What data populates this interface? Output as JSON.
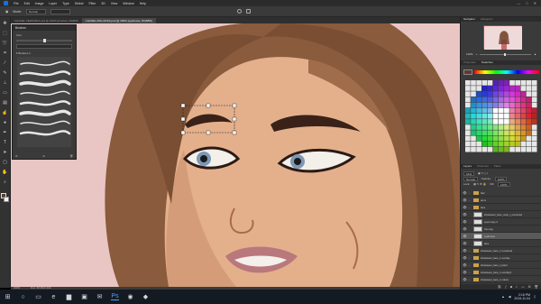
{
  "menu": {
    "items": [
      "File",
      "Edit",
      "Image",
      "Layer",
      "Type",
      "Select",
      "Filter",
      "3D",
      "View",
      "Window",
      "Help"
    ],
    "window_controls": [
      "—",
      "□",
      "✕"
    ]
  },
  "options": {
    "mode_label": "Mode:",
    "mode_value": "Normal",
    "icons": [
      "check-icon",
      "cancel-icon"
    ]
  },
  "tabs": [
    {
      "label": "CHANEL VERONIKA.psd @ 100% (brushes, RGB/8)",
      "active": false
    },
    {
      "label": "CHANEL MILLONKA.psd @ 100% (eyebrows, RGB/8#)",
      "active": true
    }
  ],
  "tools": [
    "move-icon",
    "marquee-icon",
    "lasso-icon",
    "crop-icon",
    "eyedropper-icon",
    "brush-icon",
    "stamp-icon",
    "eraser-icon",
    "gradient-icon",
    "smudge-icon",
    "dodge-icon",
    "pen-icon",
    "type-icon",
    "path-select-icon",
    "shape-icon",
    "hand-icon",
    "zoom-icon"
  ],
  "brushes_panel": {
    "title": "Brushes",
    "size_label": "Size:",
    "folder_label": "Brushes 1",
    "stroke_count": 8
  },
  "navigator": {
    "tabs": [
      "Navigator",
      "Histogram"
    ],
    "zoom_value": "100%",
    "zoom_fraction": 0.48
  },
  "swatches": {
    "tabs": [
      "Properties",
      "Swatches"
    ]
  },
  "layers": {
    "tabs": [
      "Layers",
      "Channels",
      "Paths"
    ],
    "kind_label": "Kind",
    "blend_mode": "Normal",
    "opacity_label": "Opacity:",
    "opacity_value": "100%",
    "lock_label": "Lock:",
    "fill_label": "Fill:",
    "fill_value": "100%",
    "items": [
      {
        "name": "hair",
        "type": "folder",
        "selected": false
      },
      {
        "name": "arms",
        "type": "folder",
        "selected": false
      },
      {
        "name": "face",
        "type": "folder",
        "selected": false
      },
      {
        "name": "inbetween_face_sofa_t_recolored",
        "type": "layer",
        "selected": false
      },
      {
        "name": "eyes copy 2",
        "type": "layer",
        "selected": false
      },
      {
        "name": "Iris copy",
        "type": "layer",
        "selected": false
      },
      {
        "name": "eyebrows",
        "type": "layer",
        "selected": true
      },
      {
        "name": "face",
        "type": "layer",
        "selected": false
      },
      {
        "name": "inbetween_face_1 recolored",
        "type": "folder",
        "selected": false
      },
      {
        "name": "inbetween_face_1 overlay",
        "type": "folder",
        "selected": false
      },
      {
        "name": "inbetween_face_1 paint",
        "type": "folder",
        "selected": false
      },
      {
        "name": "inbetween_face_1 overlay2",
        "type": "folder",
        "selected": false
      },
      {
        "name": "inbetween_face_1 colors",
        "type": "folder",
        "selected": false
      }
    ],
    "footer_icons": [
      "link-icon",
      "fx-icon",
      "mask-icon",
      "adjustment-icon",
      "group-icon",
      "new-layer-icon",
      "trash-icon"
    ]
  },
  "status": {
    "zoom": "100%",
    "doc": "Doc: 38.4M/1.42G"
  },
  "taskbar": {
    "apps": [
      "windows-icon",
      "search-icon",
      "taskview-icon",
      "edge-icon",
      "explorer-icon",
      "store-icon",
      "mail-icon",
      "photoshop-icon",
      "chrome-icon",
      "app-icon"
    ],
    "time": "2:16 PM",
    "date": "2019-11-04"
  },
  "colors": {
    "skin": "#e4b08c",
    "hair": "#8a5b3c",
    "background": "#e9c6c4",
    "accent": "#1c6fd1"
  }
}
